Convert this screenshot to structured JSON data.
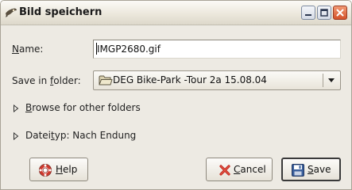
{
  "window": {
    "title": "Bild speichern",
    "controls": {
      "minimize_icon": "minimize-icon",
      "maximize_icon": "maximize-icon",
      "close_icon": "close-icon"
    }
  },
  "form": {
    "name_label_mnemonic": "N",
    "name_label_rest": "ame:",
    "name_value": "IMGP2680.gif",
    "folder_label_before": "Save in ",
    "folder_label_mnemonic": "f",
    "folder_label_after": "older:",
    "folder_value": "DEG Bike-Park -Tour 2a 15.08.04",
    "folder_icon": "folder-icon"
  },
  "expanders": {
    "browse_mnemonic": "B",
    "browse_rest": "rowse for other folders",
    "filetype_before": "Datei",
    "filetype_mnemonic": "t",
    "filetype_after": "yp: Nach Endung"
  },
  "buttons": {
    "help_mnemonic": "H",
    "help_rest": "elp",
    "cancel_mnemonic": "C",
    "cancel_rest": "ancel",
    "save_mnemonic": "S",
    "save_rest": "ave"
  },
  "colors": {
    "dialog_background": "#edeae3",
    "close_button": "#d4522a",
    "cancel_icon": "#c0281c",
    "help_icon_ring": "#d0362a",
    "save_icon": "#3a5f9c"
  }
}
